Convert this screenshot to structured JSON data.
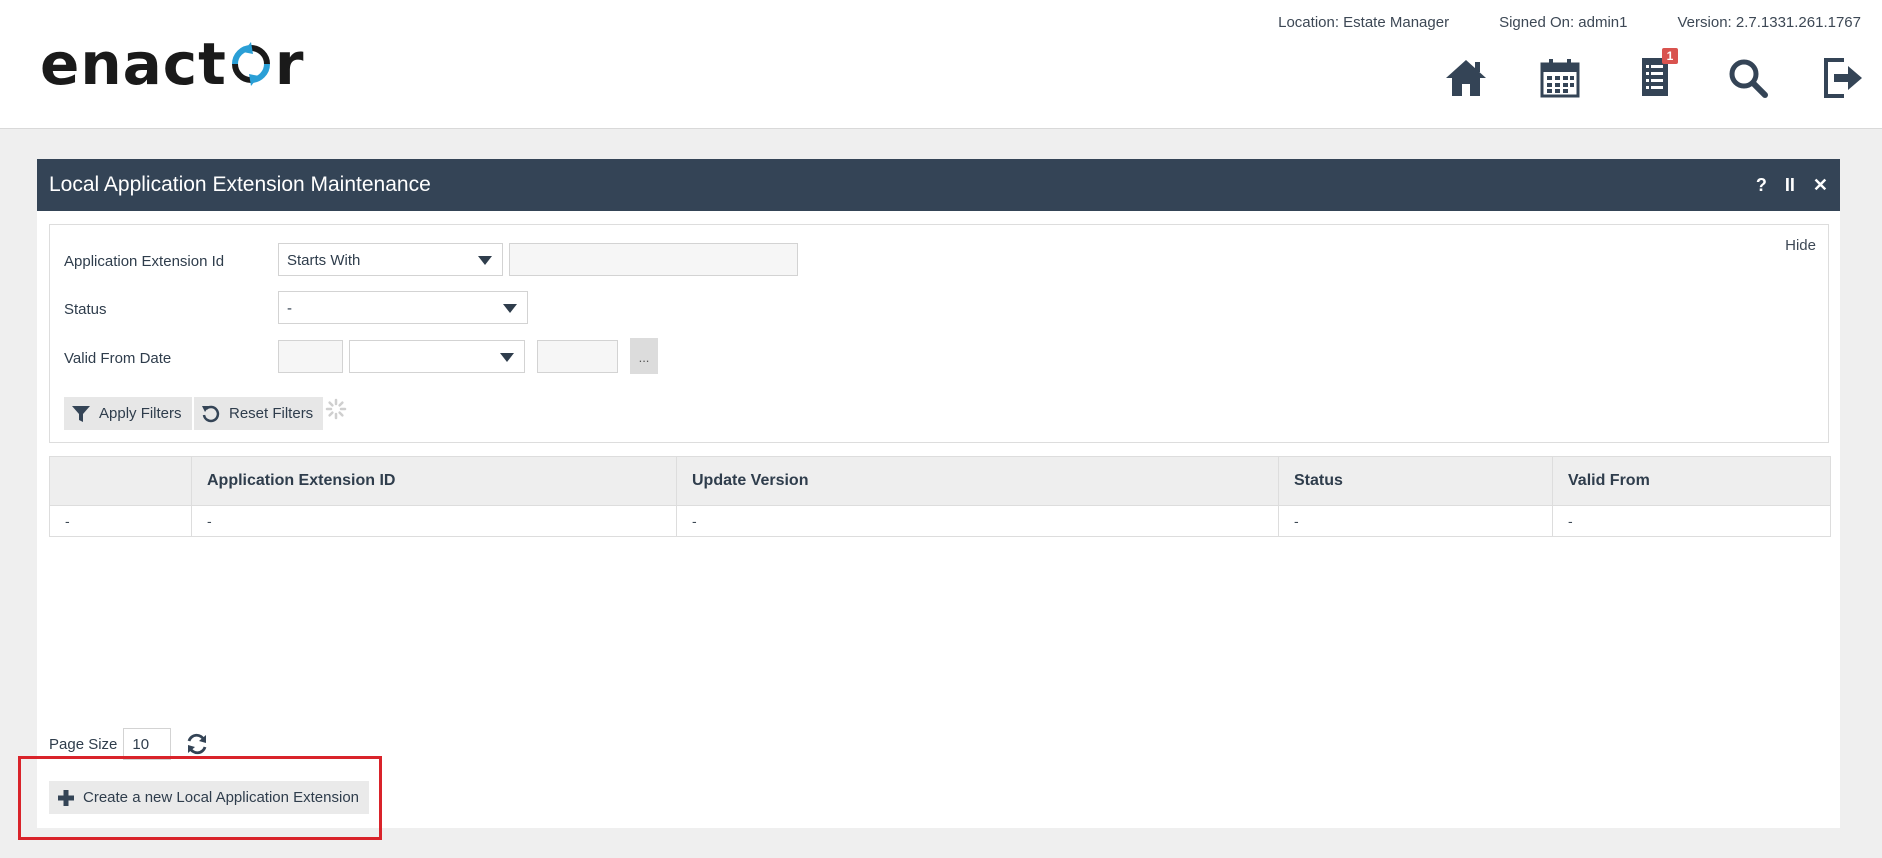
{
  "header": {
    "logo_text_left": "enact",
    "logo_text_right": "r",
    "location": "Location: Estate Manager",
    "signed_on": "Signed On: admin1",
    "version": "Version: 2.7.1331.261.1767",
    "notification_count": "1",
    "icons": [
      "home-icon",
      "calendar-icon",
      "notifications-icon",
      "search-icon",
      "logout-icon"
    ]
  },
  "panel": {
    "title": "Local Application Extension Maintenance",
    "tools": {
      "help": "?",
      "pause": "II",
      "close": "✕"
    }
  },
  "filters": {
    "hide_label": "Hide",
    "app_ext_id": {
      "label": "Application Extension Id",
      "operator": "Starts With",
      "value": ""
    },
    "status": {
      "label": "Status",
      "value": "-"
    },
    "valid_from": {
      "label": "Valid From Date",
      "operator": "",
      "ellipsis": "..."
    },
    "apply_label": "Apply Filters",
    "reset_label": "Reset Filters"
  },
  "grid": {
    "columns": [
      "",
      "Application Extension ID",
      "Update Version",
      "Status",
      "Valid From"
    ],
    "rows": [
      [
        "-",
        "-",
        "-",
        "-",
        "-"
      ]
    ]
  },
  "footer": {
    "page_size_label": "Page Size",
    "page_size": "10",
    "create_label": "Create a new Local Application Extension"
  },
  "colors": {
    "header_bar": "#344456",
    "logo_accent": "#2a9fd6",
    "highlight": "#d9232a",
    "badge": "#d9534f"
  }
}
